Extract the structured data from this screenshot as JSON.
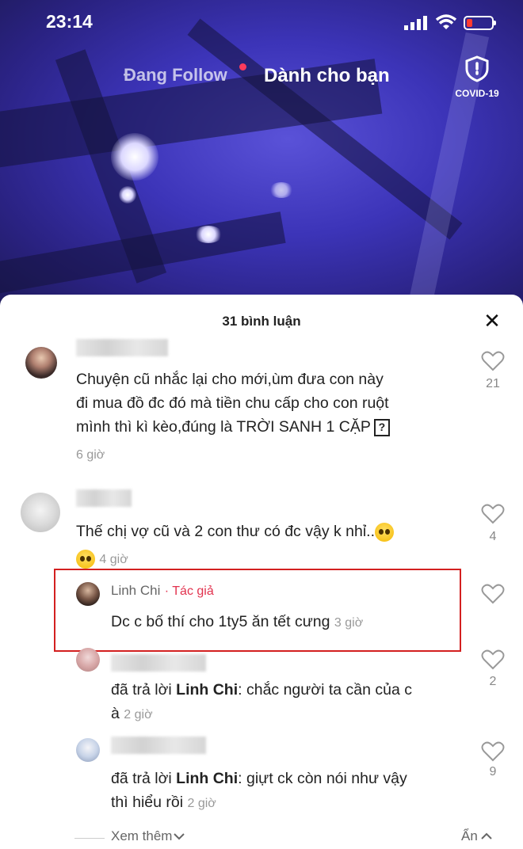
{
  "status_bar": {
    "time": "23:14"
  },
  "top_nav": {
    "following": "Đang Follow",
    "for_you": "Dành cho bạn",
    "covid_label": "COVID-19"
  },
  "comments_sheet": {
    "title": "31 bình luận",
    "close": "✕",
    "comments": [
      {
        "text_line1": "Chuyện cũ nhắc lại cho mới,ùm đưa con này",
        "text_line2": "đi mua đồ đc đó mà tiền chu cấp cho con ruột",
        "text_line3": "mình thì kì kèo,đúng là TRỜI SANH 1 CẶP",
        "qmark": "?",
        "time": "6 giờ",
        "likes": "21"
      },
      {
        "text_line1": "Thế chị vợ cũ và 2 con thư có đc vậy k nhỉ..",
        "time": "4 giờ",
        "likes": "4"
      }
    ],
    "replies": [
      {
        "author": "Linh Chi",
        "tag": "· Tác giả",
        "text": "Dc c bố thí cho 1ty5 ăn tết cưng",
        "time": "3 giờ"
      },
      {
        "prefix": "đã trả lời",
        "mention": "Linh Chi",
        "text_line1": ": chắc người ta cần của c",
        "text_line2": "à",
        "time": "2 giờ",
        "likes": "2"
      },
      {
        "prefix": "đã trả lời",
        "mention": "Linh Chi",
        "text_line1": ": giựt ck còn nói như vậy",
        "text_line2": "thì hiểu rồi",
        "time": "2 giờ",
        "likes": "9"
      }
    ],
    "see_more": "Xem thêm",
    "hide": "Ẩn"
  }
}
